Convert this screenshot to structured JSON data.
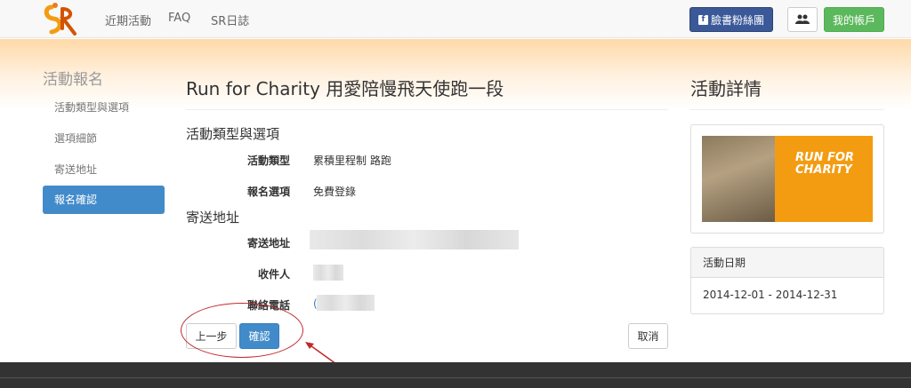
{
  "nav": {
    "links": [
      "近期活動",
      "FAQ",
      "SR日誌"
    ],
    "facebook_label": "臉書粉絲團",
    "account_label": "我的帳戶"
  },
  "sidebar": {
    "title": "活動報名",
    "items": [
      {
        "label": "活動類型與選項",
        "active": false
      },
      {
        "label": "選項細節",
        "active": false
      },
      {
        "label": "寄送地址",
        "active": false
      },
      {
        "label": "報名確認",
        "active": true
      }
    ]
  },
  "main": {
    "title": "Run for Charity 用愛陪慢飛天使跑一段",
    "section_type": "活動類型與選項",
    "fields_type": [
      {
        "label": "活動類型",
        "value": "累積里程制 路跑"
      },
      {
        "label": "報名選項",
        "value": "免費登錄"
      }
    ],
    "section_address": "寄送地址",
    "fields_address": [
      {
        "label": "寄送地址",
        "value": ""
      },
      {
        "label": "收件人",
        "value": ""
      },
      {
        "label": "聯絡電話",
        "value": "("
      }
    ],
    "prev_label": "上一步",
    "confirm_label": "確認",
    "cancel_label": "取消"
  },
  "right": {
    "title": "活動詳情",
    "banner_text": "RUN FOR CHARITY",
    "date_heading": "活動日期",
    "date_range": "2014-12-01 - 2014-12-31"
  },
  "colors": {
    "primary": "#428bca",
    "success": "#5cb85c",
    "facebook": "#3b5998",
    "annotation": "#c0282d"
  }
}
